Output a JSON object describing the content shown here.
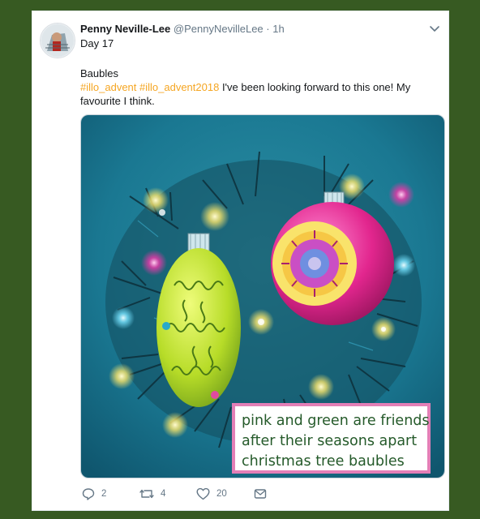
{
  "tweet": {
    "author_name": "Penny Neville-Lee",
    "handle": "@PennyNevilleLee",
    "separator": "·",
    "time": "1h",
    "day_line": "Day 17",
    "title_line": "Baubles",
    "hashtag_1": "#illo_advent",
    "hashtag_2": "#illo_advent2018",
    "text_rest": " I've been looking forward to this one! My favourite I think.",
    "caption_lines": [
      "pink and green are friends",
      "after their seasons apart",
      "christmas tree baubles"
    ],
    "reply_count": "2",
    "retweet_count": "4",
    "like_count": "20"
  },
  "icons": {
    "menu": "chevron-down-icon",
    "reply": "reply-icon",
    "retweet": "retweet-icon",
    "like": "heart-icon",
    "dm": "envelope-icon"
  },
  "colors": {
    "background": "#375a22",
    "hashtag": "#f5a623",
    "caption_border": "#e37fb7",
    "caption_text": "#255a2a"
  }
}
